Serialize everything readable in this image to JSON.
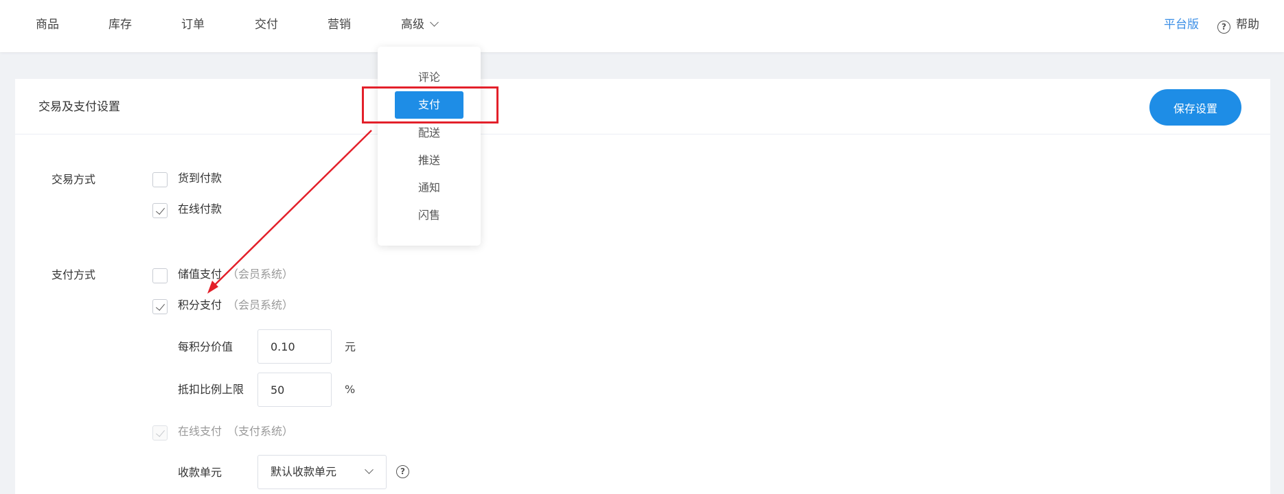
{
  "nav": {
    "items": [
      "商品",
      "库存",
      "订单",
      "交付",
      "营销"
    ],
    "advanced": "高级",
    "platform": "平台版",
    "help": "帮助"
  },
  "dropdown": {
    "items": [
      "评论",
      "支付",
      "配送",
      "推送",
      "通知",
      "闪售"
    ],
    "active_item": "支付"
  },
  "card": {
    "title": "交易及支付设置",
    "save_label": "保存设置"
  },
  "trade": {
    "label": "交易方式",
    "options": [
      {
        "label": "货到付款",
        "checked": false
      },
      {
        "label": "在线付款",
        "checked": true
      }
    ]
  },
  "payment": {
    "label": "支付方式",
    "stored_value": {
      "label": "储值支付",
      "note": "（会员系统）",
      "checked": false
    },
    "points": {
      "label": "积分支付",
      "note": "（会员系统）",
      "checked": true
    },
    "points_value": {
      "label": "每积分价值",
      "value": "0.10",
      "unit": "元"
    },
    "deduct_limit": {
      "label": "抵扣比例上限",
      "value": "50",
      "unit": "%"
    },
    "online": {
      "label": "在线支付",
      "note": "（支付系统）",
      "checked": true,
      "disabled": true
    },
    "receiving_unit": {
      "label": "收款单元",
      "value": "默认收款单元"
    }
  },
  "colors": {
    "accent": "#1e8de6",
    "annotation": "#e3202a",
    "platform_link": "#3a8ee6"
  }
}
